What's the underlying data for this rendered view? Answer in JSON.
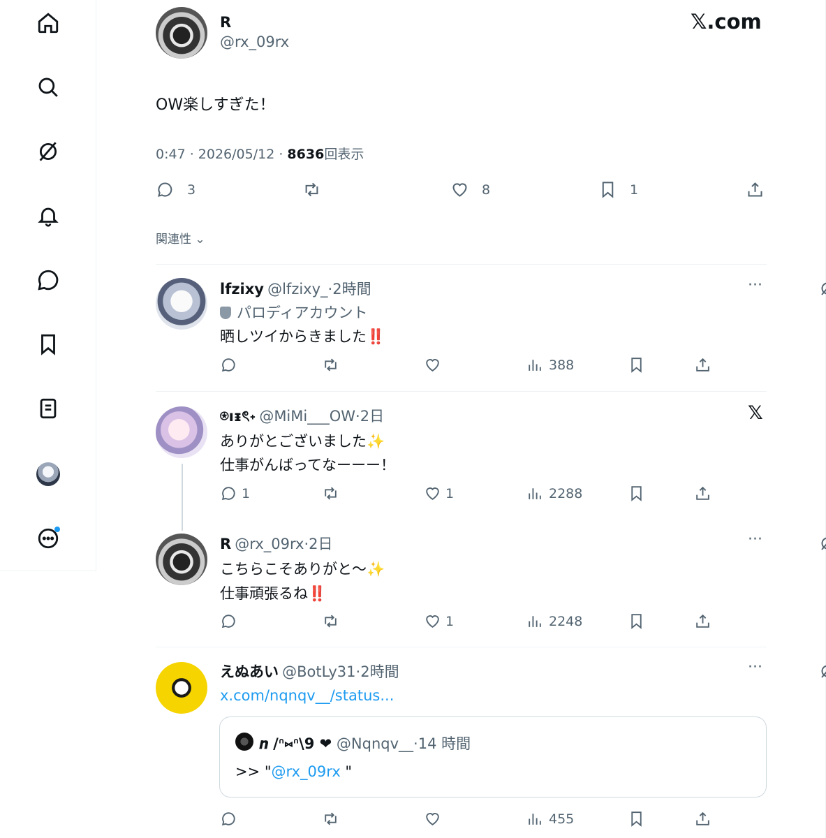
{
  "nav": {
    "items": [
      {
        "name": "home-icon"
      },
      {
        "name": "search-icon"
      },
      {
        "name": "grok-icon"
      },
      {
        "name": "notifications-icon"
      },
      {
        "name": "messages-icon"
      },
      {
        "name": "bookmarks-icon"
      },
      {
        "name": "lists-icon"
      },
      {
        "name": "profile-avatar"
      },
      {
        "name": "more-icon"
      }
    ]
  },
  "post": {
    "author_name": "R",
    "author_handle": "@rx_09rx",
    "brand": "𝕏.com",
    "body": "OW楽しすぎた！",
    "time": "0:47 · 2026/05/12 · ",
    "views_count": "8636",
    "views_label": "回表示",
    "reply_count": "3",
    "like_count": "8",
    "bookmark_count": "1"
  },
  "sort": {
    "label": "関連性"
  },
  "replies": [
    {
      "name": "lfzixy",
      "handle": "@lfzixy_",
      "sep": "·",
      "time": "2時間",
      "badge_label": "パロディアカウント",
      "line1": "晒しツイからきました",
      "line1_emoji": "‼️",
      "views": "388"
    },
    {
      "name": "⍟ıᵻৎ˖",
      "handle": "@MiMi___OW",
      "sep": "·",
      "time": "2日",
      "line1": "ありがとございました",
      "line1_emoji": "✨",
      "line2": "仕事がんばってなーーー！",
      "reply_count": "1",
      "like_count": "1",
      "views": "2288"
    },
    {
      "name": "R",
      "handle": "@rx_09rx",
      "sep": "·",
      "time": "2日",
      "line1": "こちらこそありがと〜",
      "line1_emoji": "✨",
      "line2": "仕事頑張るね",
      "line2_emoji": "‼️",
      "like_count": "1",
      "views": "2248"
    },
    {
      "name": "えぬあい",
      "handle": "@BotLy31",
      "sep": "·",
      "time": "2時間",
      "link": "x.com/nqnqv__/status...",
      "quote": {
        "name": "𝒏 /ᐢ⑅ᐢ\\9 ❤",
        "handle": "@Nqnqv__",
        "sep": "·",
        "time": "14 時間",
        "text_prefix": ">> \"",
        "mention": "@rx_09rx",
        "text_suffix": " \""
      },
      "views": "455"
    }
  ]
}
